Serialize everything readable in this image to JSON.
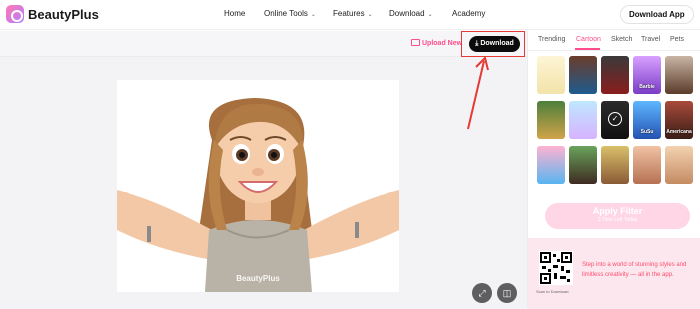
{
  "header": {
    "brand": "BeautyPlus",
    "nav": [
      {
        "label": "Home",
        "chevron": false
      },
      {
        "label": "Online Tools",
        "chevron": true
      },
      {
        "label": "Features",
        "chevron": true
      },
      {
        "label": "Download",
        "chevron": true
      },
      {
        "label": "Academy",
        "chevron": false
      }
    ],
    "download_app": "Download App"
  },
  "toolbar": {
    "upload_new": "Upload New",
    "download": "Download"
  },
  "canvas": {
    "watermark": "BeautyPlus"
  },
  "controls": {
    "expand_icon": "expand-icon",
    "compare_icon": "compare-icon"
  },
  "panel": {
    "tabs": [
      "Trending",
      "Cartoon",
      "Sketch",
      "Travel",
      "Pets"
    ],
    "active_tab": "Cartoon",
    "thumbnails": [
      {
        "label": "",
        "bg": "linear-gradient(#fdf5d6,#f2e3a8)"
      },
      {
        "label": "",
        "bg": "linear-gradient(#6b3c2a,#1e5b8f)"
      },
      {
        "label": "",
        "bg": "linear-gradient(#3a3a3a,#8b1d1d)"
      },
      {
        "label": "Barbie",
        "bg": "linear-gradient(#d8a0ff,#7a3cc7)"
      },
      {
        "label": "",
        "bg": "linear-gradient(#c9b4a4,#5b3b2a)"
      },
      {
        "label": "",
        "bg": "linear-gradient(#4d7f3a,#d1a34a)"
      },
      {
        "label": "",
        "bg": "linear-gradient(#bfe7ff,#d6b3ff)"
      },
      {
        "label": "",
        "bg": "linear-gradient(#2b2b2b,#111)",
        "selected": true
      },
      {
        "label": "SuSu",
        "bg": "linear-gradient(#5fb7ff,#2452b3)"
      },
      {
        "label": "Americana",
        "bg": "linear-gradient(#a84b3a,#3b1d17)"
      },
      {
        "label": "",
        "bg": "linear-gradient(#ffb3d1,#58b4f0)"
      },
      {
        "label": "",
        "bg": "linear-gradient(#6aa35b,#3e2b22)"
      },
      {
        "label": "",
        "bg": "linear-gradient(#d9c06a,#8a5a36)"
      },
      {
        "label": "",
        "bg": "linear-gradient(#f1c2a4,#b57152)"
      },
      {
        "label": "",
        "bg": "linear-gradient(#f3d2b0,#c48b62)"
      }
    ],
    "apply_label": "Apply Filter",
    "apply_sub": "3 Time Left Today",
    "promo": {
      "caption": "Scan to Download",
      "text": "Step into a world of stunning styles and limitless creativity — all in the app."
    }
  },
  "colors": {
    "accent": "#ff4d8d",
    "highlight": "#e53935",
    "dark_button": "#0b0b0b"
  }
}
